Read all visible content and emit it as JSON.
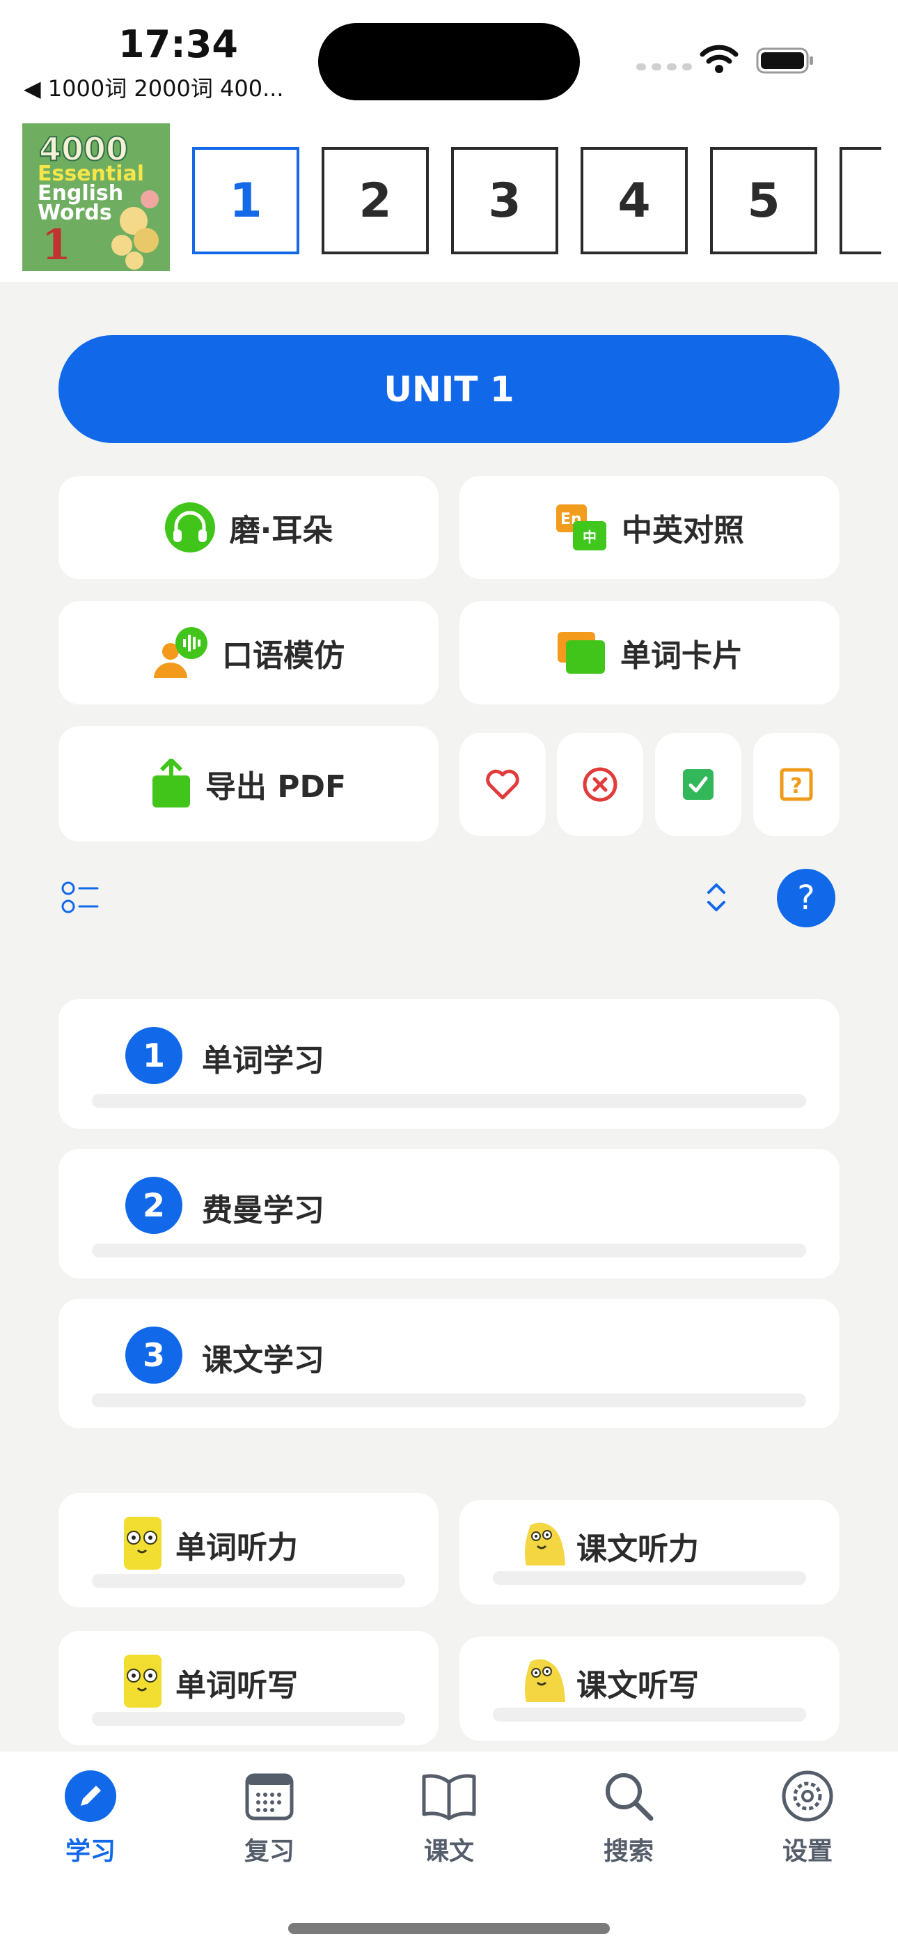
{
  "status_bar": {
    "time": "17:34",
    "back_label": "◀ 1000词 2000词 400..."
  },
  "book": {
    "cover_line1": "4000",
    "cover_line2": "Essential",
    "cover_line3": "English",
    "cover_line4": "Words",
    "cover_volume": "1",
    "units": [
      "1",
      "2",
      "3",
      "4",
      "5"
    ],
    "selected_unit": "1"
  },
  "unit_banner": "UNIT 1",
  "actions": {
    "grind_ears": "磨·耳朵",
    "bilingual": "中英对照",
    "bilingual_badge_en": "En",
    "bilingual_badge_zh": "中",
    "oral_mimic": "口语模仿",
    "word_cards": "单词卡片",
    "export_pdf": "导出 PDF"
  },
  "filters": {
    "favorite_icon": "heart-icon",
    "wrong_icon": "x-circle-icon",
    "known_icon": "check-square-icon",
    "unknown_icon": "question-square-icon",
    "help_label": "?"
  },
  "study_steps": [
    {
      "number": "1",
      "label": "单词学习"
    },
    {
      "number": "2",
      "label": "费曼学习"
    },
    {
      "number": "3",
      "label": "课文学习"
    }
  ],
  "listening": {
    "word_listening": "单词听力",
    "text_listening": "课文听力",
    "word_dictation": "单词听写",
    "text_dictation": "课文听写"
  },
  "tabs": [
    {
      "label": "学习",
      "icon": "pencil-icon",
      "active": true
    },
    {
      "label": "复习",
      "icon": "calendar-icon",
      "active": false
    },
    {
      "label": "课文",
      "icon": "book-icon",
      "active": false
    },
    {
      "label": "搜索",
      "icon": "search-icon",
      "active": false
    },
    {
      "label": "设置",
      "icon": "gear-icon",
      "active": false
    }
  ],
  "colors": {
    "accent": "#1169ea",
    "background": "#f3f3f2",
    "heart": "#e23b3b",
    "check": "#32b85a",
    "question": "#f09a1a"
  }
}
